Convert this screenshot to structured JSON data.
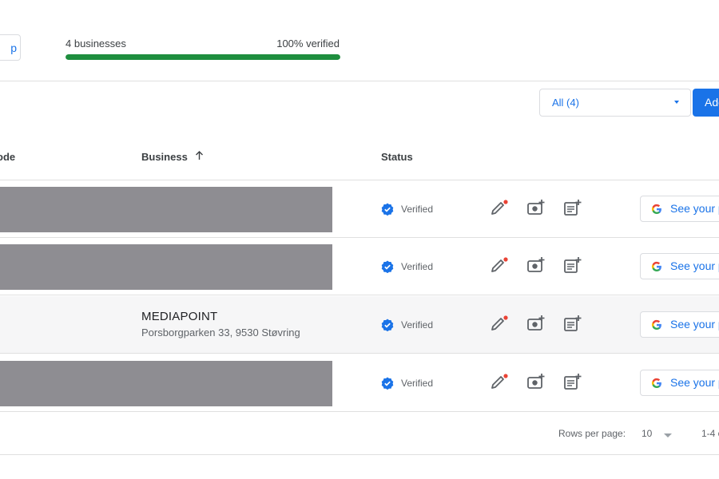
{
  "top": {
    "left_button_label": "p",
    "business_count": "4 businesses",
    "verified_percent": "100% verified",
    "progress_fraction": 1.0,
    "progress_color": "#1e8e3e"
  },
  "toolbar": {
    "filter_value": "All (4)",
    "add_label": "Add"
  },
  "table": {
    "headers": {
      "code": "ode",
      "business": "Business",
      "business_sort_icon": "arrow-up-icon",
      "status": "Status"
    },
    "rows": [
      {
        "redacted": true,
        "name": "",
        "address": "",
        "status": "Verified"
      },
      {
        "redacted": true,
        "name": "",
        "address": "",
        "status": "Verified"
      },
      {
        "redacted": false,
        "name": "MEDIAPOINT",
        "address": "Porsborgparken 33, 9530 Støvring",
        "status": "Verified"
      },
      {
        "redacted": true,
        "name": "",
        "address": "",
        "status": "Verified"
      }
    ],
    "row_action_icons": [
      "edit-pencil-icon",
      "add-photo-icon",
      "add-post-icon"
    ],
    "see_button_label": "See your p"
  },
  "footer": {
    "rows_per_page_label": "Rows per page:",
    "rows_per_page_value": "10",
    "range_text": "1-4 o"
  },
  "colors": {
    "accent": "#1a73e8",
    "verified_blue": "#1a73e8",
    "notification_dot": "#ea4335",
    "redaction_gray": "#8e8d92"
  }
}
